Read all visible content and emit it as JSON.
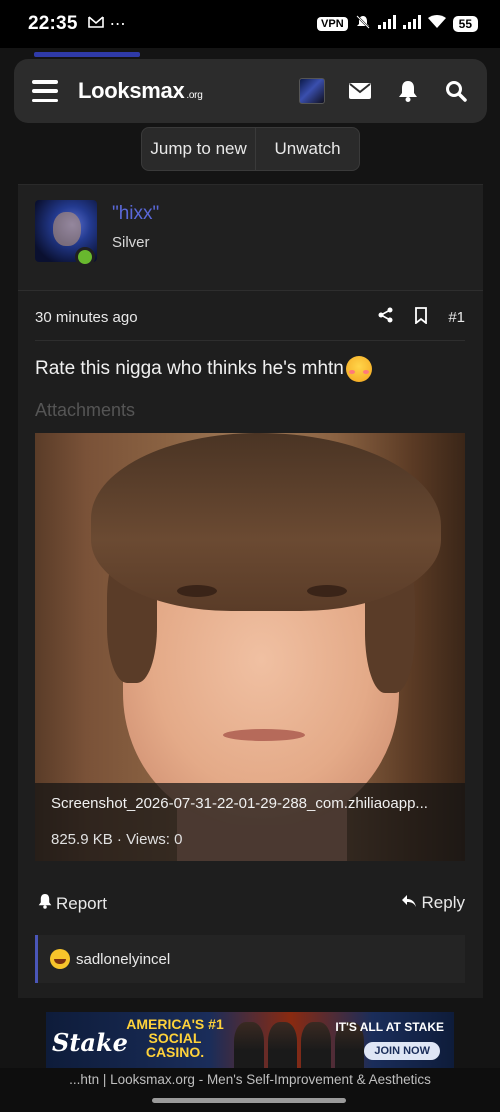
{
  "status_bar": {
    "time": "22:35",
    "left_icons": [
      "gmail-icon",
      "more-dots-icon"
    ],
    "vpn": "VPN",
    "battery": "55"
  },
  "header": {
    "logo_main": "Looksmax",
    "logo_suffix": ".org",
    "icons": [
      "menu-icon",
      "mail-icon",
      "bell-icon",
      "search-icon"
    ]
  },
  "thread_actions": {
    "jump_to_new": "Jump to new",
    "unwatch": "Unwatch"
  },
  "post": {
    "username": "\"hixx\"",
    "rank": "Silver",
    "time": "30 minutes ago",
    "number": "#1",
    "body": "Rate this nigga who thinks he's mhtn",
    "attachments_label": "Attachments",
    "attachment": {
      "filename": "Screenshot_2026-07-31-22-01-29-288_com.zhiliaoapp...",
      "size": "825.9 KB",
      "separator": "·",
      "views": "Views: 0"
    },
    "report_label": "Report",
    "reply_label": "Reply",
    "reaction_user": "sadlonelyincel"
  },
  "ad": {
    "brand": "Stake",
    "headline": "AMERICA'S #1 SOCIAL CASINO.",
    "tagline": "IT'S ALL AT STAKE",
    "cta": "JOIN NOW"
  },
  "footer": {
    "text": "...htn | Looksmax.org - Men's Self-Improvement & Aesthetics"
  }
}
